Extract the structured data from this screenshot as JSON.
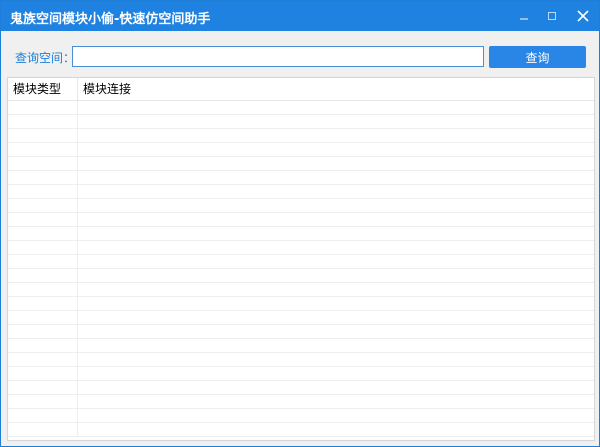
{
  "window": {
    "title": "鬼族空间模块小偷-快速仿空间助手",
    "controls": [
      "minimize-icon",
      "maximize-icon",
      "close-icon"
    ]
  },
  "search": {
    "label": "查询空间：",
    "value": "",
    "placeholder": "",
    "button_label": "查询"
  },
  "table": {
    "columns": [
      "模块类型",
      "模块连接"
    ],
    "rows": []
  },
  "colors": {
    "titlebar": "#1f82e0",
    "accent": "#2a86e6",
    "label": "#1f7fd8"
  }
}
